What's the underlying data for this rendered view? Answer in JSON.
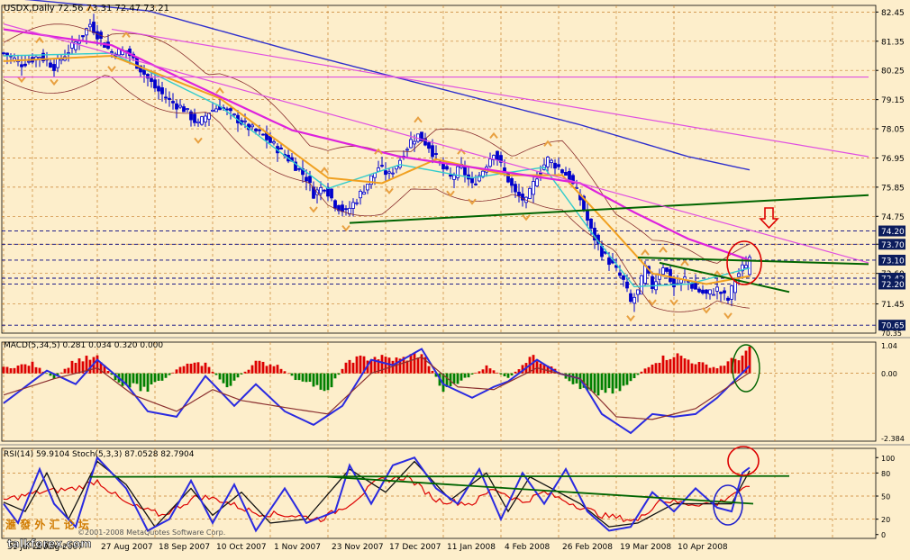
{
  "header": {
    "main": "USDX,Daily  72.56 73.31 72.47 73.21",
    "macd": "MACD(5,34,5) 0.281 0.034 0.320 0.000",
    "rsi": "RSI(14) 59.9104  Stoch(5,3,3) 87.0528 82.7904"
  },
  "watermark": {
    "cn": "滙 發 外 汇 论 坛",
    "site": "talkforex.com",
    "meta": "©2001-2008 MetaQuotes Software Corp."
  },
  "colors": {
    "bg": "#fdeecb",
    "grid": "#c8802c",
    "price": "#0000cc",
    "ma_fast": "#33cccc",
    "ma_orange": "#f0a020",
    "ma_magenta": "#dd22dd",
    "ma_blue": "#3030cc",
    "ma_brown": "#8b3030",
    "trend_green": "#006400",
    "trend_pink": "#e050e0",
    "hist_up": "#dd0000",
    "hist_down": "#008000",
    "fractal": "#e8a040",
    "level_line": "#000080",
    "circle_red": "#dd0000",
    "circle_green": "#006400",
    "circle_blue": "#2020cc"
  },
  "chart_data": [
    {
      "type": "candlestick",
      "panel": "price",
      "symbol": "USDX",
      "timeframe": "Daily",
      "last_ohlc": {
        "open": 72.56,
        "high": 73.31,
        "low": 72.47,
        "close": 73.21
      },
      "ylim": [
        70.35,
        82.7
      ],
      "yticks": [
        "82.45",
        "81.35",
        "80.25",
        "79.15",
        "78.05",
        "76.95",
        "75.85",
        "74.75",
        "73.70",
        "72.60",
        "71.45"
      ],
      "level_labels": [
        {
          "label": "74.20",
          "value": 74.2
        },
        {
          "label": "73.70",
          "value": 73.7
        },
        {
          "label": "73.10",
          "value": 73.1
        },
        {
          "label": "72.42",
          "value": 72.42
        },
        {
          "label": "72.20",
          "value": 72.2
        },
        {
          "label": "70.65",
          "value": 70.65
        }
      ],
      "bottom_label": "70.35",
      "xticks": [
        "31 Jul 2007",
        "2 Aug 2007",
        "27 Aug 2007",
        "18 Sep 2007",
        "10 Oct 2007",
        "1 Nov 2007",
        "23 Nov 2007",
        "17 Dec 2007",
        "11 Jan 2008",
        "4 Feb 2008",
        "26 Feb 2008",
        "19 Mar 2008",
        "10 Apr 2008"
      ],
      "close_keypoints": [
        [
          0,
          80.9
        ],
        [
          5,
          80.5
        ],
        [
          10,
          80.8
        ],
        [
          14,
          80.4
        ],
        [
          18,
          81.0
        ],
        [
          22,
          81.6
        ],
        [
          24,
          82.0
        ],
        [
          27,
          81.4
        ],
        [
          30,
          80.9
        ],
        [
          34,
          81.0
        ],
        [
          38,
          80.3
        ],
        [
          42,
          79.6
        ],
        [
          46,
          79.1
        ],
        [
          50,
          78.8
        ],
        [
          54,
          78.2
        ],
        [
          57,
          78.7
        ],
        [
          60,
          78.9
        ],
        [
          64,
          78.5
        ],
        [
          68,
          78.1
        ],
        [
          72,
          77.8
        ],
        [
          76,
          77.3
        ],
        [
          80,
          76.8
        ],
        [
          84,
          76.2
        ],
        [
          86,
          75.6
        ],
        [
          89,
          75.9
        ],
        [
          92,
          75.2
        ],
        [
          95,
          74.9
        ],
        [
          98,
          75.4
        ],
        [
          101,
          76.0
        ],
        [
          104,
          76.6
        ],
        [
          107,
          76.3
        ],
        [
          110,
          76.9
        ],
        [
          113,
          77.6
        ],
        [
          115,
          77.8
        ],
        [
          118,
          77.4
        ],
        [
          121,
          76.7
        ],
        [
          124,
          76.2
        ],
        [
          127,
          76.6
        ],
        [
          130,
          75.9
        ],
        [
          133,
          76.5
        ],
        [
          136,
          77.2
        ],
        [
          139,
          76.4
        ],
        [
          142,
          75.6
        ],
        [
          145,
          75.3
        ],
        [
          148,
          76.3
        ],
        [
          151,
          76.9
        ],
        [
          154,
          76.6
        ],
        [
          157,
          76.2
        ],
        [
          160,
          75.4
        ],
        [
          163,
          74.2
        ],
        [
          166,
          73.4
        ],
        [
          169,
          72.9
        ],
        [
          172,
          72.3
        ],
        [
          174,
          71.5
        ],
        [
          176,
          71.9
        ],
        [
          178,
          72.8
        ],
        [
          180,
          72.1
        ],
        [
          183,
          72.9
        ],
        [
          186,
          72.1
        ],
        [
          189,
          72.4
        ],
        [
          192,
          72.0
        ],
        [
          195,
          71.8
        ],
        [
          198,
          72.0
        ],
        [
          201,
          71.6
        ],
        [
          203,
          72.4
        ],
        [
          205,
          72.8
        ],
        [
          207,
          73.2
        ]
      ],
      "moving_averages": [
        {
          "role": "ma_fast",
          "keypoints": [
            [
              0,
              80.8
            ],
            [
              30,
              80.9
            ],
            [
              60,
              78.9
            ],
            [
              90,
              75.8
            ],
            [
              110,
              76.7
            ],
            [
              130,
              76.2
            ],
            [
              150,
              76.6
            ],
            [
              165,
              73.8
            ],
            [
              175,
              72.1
            ],
            [
              190,
              72.2
            ],
            [
              207,
              72.8
            ]
          ]
        },
        {
          "role": "ma_orange",
          "keypoints": [
            [
              0,
              80.6
            ],
            [
              30,
              80.8
            ],
            [
              60,
              79.2
            ],
            [
              90,
              76.2
            ],
            [
              105,
              76.0
            ],
            [
              120,
              76.9
            ],
            [
              140,
              76.3
            ],
            [
              155,
              76.3
            ],
            [
              168,
              74.4
            ],
            [
              180,
              72.6
            ],
            [
              195,
              72.2
            ],
            [
              207,
              72.5
            ]
          ]
        },
        {
          "role": "ma_magenta",
          "keypoints": [
            [
              0,
              81.8
            ],
            [
              30,
              81.2
            ],
            [
              50,
              79.9
            ],
            [
              80,
              78.0
            ],
            [
              110,
              77.0
            ],
            [
              140,
              76.4
            ],
            [
              160,
              76.0
            ],
            [
              175,
              74.9
            ],
            [
              190,
              73.9
            ],
            [
              207,
              73.1
            ]
          ]
        },
        {
          "role": "ma_blue",
          "keypoints": [
            [
              0,
              83.0
            ],
            [
              40,
              82.5
            ],
            [
              80,
              81.0
            ],
            [
              120,
              79.6
            ],
            [
              160,
              78.2
            ],
            [
              190,
              77.0
            ],
            [
              207,
              76.5
            ]
          ]
        }
      ],
      "trendlines": [
        {
          "role": "trend_green",
          "from": [
            96,
            74.5
          ],
          "to": [
            240,
            75.55
          ]
        },
        {
          "role": "trend_green",
          "from": [
            176,
            73.2
          ],
          "to": [
            240,
            72.95
          ]
        },
        {
          "role": "trend_green",
          "from": [
            182,
            73.0
          ],
          "to": [
            218,
            71.9
          ]
        },
        {
          "role": "trend_pink",
          "from": [
            0,
            82.0
          ],
          "to": [
            240,
            73.0
          ]
        },
        {
          "role": "trend_pink",
          "from": [
            30,
            81.8
          ],
          "to": [
            240,
            77.0
          ]
        },
        {
          "role": "trend_pink",
          "from": [
            0,
            80.0
          ],
          "to": [
            240,
            80.0
          ]
        }
      ]
    },
    {
      "type": "bar",
      "panel": "macd",
      "ylim": [
        -2.5,
        1.15
      ],
      "yticks": [
        "1.04",
        "0.00",
        "-2.384"
      ],
      "histogram_keypoints": [
        [
          0,
          0.2
        ],
        [
          8,
          0.35
        ],
        [
          14,
          -0.2
        ],
        [
          20,
          0.5
        ],
        [
          26,
          0.55
        ],
        [
          32,
          -0.35
        ],
        [
          40,
          -0.6
        ],
        [
          50,
          0.3
        ],
        [
          56,
          0.35
        ],
        [
          62,
          -0.5
        ],
        [
          70,
          0.4
        ],
        [
          76,
          0.3
        ],
        [
          82,
          -0.3
        ],
        [
          90,
          -0.6
        ],
        [
          96,
          0.5
        ],
        [
          103,
          0.6
        ],
        [
          110,
          0.5
        ],
        [
          116,
          0.75
        ],
        [
          122,
          -0.6
        ],
        [
          128,
          -0.2
        ],
        [
          134,
          0.25
        ],
        [
          140,
          -0.2
        ],
        [
          146,
          0.6
        ],
        [
          152,
          0.3
        ],
        [
          158,
          -0.4
        ],
        [
          166,
          -0.7
        ],
        [
          172,
          -0.5
        ],
        [
          180,
          0.4
        ],
        [
          186,
          0.7
        ],
        [
          192,
          0.4
        ],
        [
          198,
          0.2
        ],
        [
          207,
          0.8
        ]
      ],
      "line_keypoints": [
        [
          0,
          -1.1
        ],
        [
          12,
          0.1
        ],
        [
          20,
          -0.4
        ],
        [
          26,
          0.5
        ],
        [
          34,
          -0.4
        ],
        [
          40,
          -1.4
        ],
        [
          48,
          -1.6
        ],
        [
          56,
          -0.1
        ],
        [
          64,
          -1.2
        ],
        [
          70,
          -0.4
        ],
        [
          78,
          -1.4
        ],
        [
          86,
          -1.9
        ],
        [
          94,
          -1.2
        ],
        [
          102,
          0.5
        ],
        [
          108,
          0.3
        ],
        [
          116,
          0.9
        ],
        [
          122,
          -0.4
        ],
        [
          130,
          -0.9
        ],
        [
          136,
          -0.5
        ],
        [
          140,
          -0.3
        ],
        [
          148,
          0.5
        ],
        [
          154,
          0.0
        ],
        [
          160,
          -0.2
        ],
        [
          166,
          -1.5
        ],
        [
          174,
          -2.2
        ],
        [
          180,
          -1.5
        ],
        [
          186,
          -1.6
        ],
        [
          192,
          -1.5
        ],
        [
          198,
          -0.9
        ],
        [
          207,
          0.28
        ]
      ],
      "signal_keypoints": [
        [
          0,
          -0.8
        ],
        [
          14,
          -0.2
        ],
        [
          26,
          0.2
        ],
        [
          36,
          -0.8
        ],
        [
          48,
          -1.4
        ],
        [
          58,
          -0.6
        ],
        [
          66,
          -1.0
        ],
        [
          80,
          -1.3
        ],
        [
          90,
          -1.5
        ],
        [
          102,
          0.0
        ],
        [
          116,
          0.6
        ],
        [
          126,
          -0.5
        ],
        [
          136,
          -0.6
        ],
        [
          148,
          0.2
        ],
        [
          160,
          -0.2
        ],
        [
          170,
          -1.6
        ],
        [
          180,
          -1.7
        ],
        [
          192,
          -1.3
        ],
        [
          207,
          0.03
        ]
      ]
    },
    {
      "type": "line",
      "panel": "rsi_stoch",
      "ylim": [
        -5,
        112
      ],
      "yticks": [
        "100",
        "80",
        "50",
        "20",
        "0"
      ],
      "hlines": [
        80,
        50,
        20
      ],
      "rsi_keypoints": [
        [
          0,
          45
        ],
        [
          10,
          55
        ],
        [
          20,
          60
        ],
        [
          26,
          70
        ],
        [
          34,
          40
        ],
        [
          44,
          25
        ],
        [
          54,
          50
        ],
        [
          60,
          45
        ],
        [
          70,
          28
        ],
        [
          80,
          25
        ],
        [
          88,
          20
        ],
        [
          96,
          40
        ],
        [
          104,
          70
        ],
        [
          112,
          75
        ],
        [
          120,
          45
        ],
        [
          130,
          40
        ],
        [
          136,
          60
        ],
        [
          144,
          42
        ],
        [
          150,
          55
        ],
        [
          158,
          40
        ],
        [
          166,
          25
        ],
        [
          176,
          18
        ],
        [
          182,
          45
        ],
        [
          190,
          40
        ],
        [
          198,
          40
        ],
        [
          203,
          55
        ],
        [
          207,
          60
        ]
      ],
      "stoch_keypoints": [
        [
          0,
          40
        ],
        [
          4,
          15
        ],
        [
          10,
          85
        ],
        [
          14,
          40
        ],
        [
          20,
          10
        ],
        [
          26,
          100
        ],
        [
          34,
          60
        ],
        [
          40,
          5
        ],
        [
          46,
          20
        ],
        [
          52,
          70
        ],
        [
          58,
          15
        ],
        [
          64,
          65
        ],
        [
          70,
          5
        ],
        [
          78,
          60
        ],
        [
          84,
          15
        ],
        [
          92,
          30
        ],
        [
          96,
          90
        ],
        [
          102,
          40
        ],
        [
          108,
          90
        ],
        [
          114,
          100
        ],
        [
          120,
          60
        ],
        [
          126,
          40
        ],
        [
          132,
          85
        ],
        [
          138,
          20
        ],
        [
          144,
          80
        ],
        [
          150,
          40
        ],
        [
          156,
          85
        ],
        [
          162,
          30
        ],
        [
          168,
          5
        ],
        [
          174,
          10
        ],
        [
          180,
          55
        ],
        [
          186,
          30
        ],
        [
          192,
          60
        ],
        [
          198,
          35
        ],
        [
          202,
          30
        ],
        [
          205,
          80
        ],
        [
          207,
          87
        ]
      ],
      "stoch_signal_keypoints": [
        [
          0,
          42
        ],
        [
          6,
          30
        ],
        [
          12,
          80
        ],
        [
          18,
          20
        ],
        [
          26,
          95
        ],
        [
          34,
          65
        ],
        [
          42,
          10
        ],
        [
          52,
          60
        ],
        [
          58,
          25
        ],
        [
          66,
          55
        ],
        [
          74,
          15
        ],
        [
          84,
          20
        ],
        [
          96,
          85
        ],
        [
          106,
          55
        ],
        [
          114,
          95
        ],
        [
          124,
          45
        ],
        [
          134,
          80
        ],
        [
          140,
          30
        ],
        [
          146,
          75
        ],
        [
          154,
          55
        ],
        [
          160,
          40
        ],
        [
          168,
          10
        ],
        [
          176,
          15
        ],
        [
          186,
          40
        ],
        [
          196,
          40
        ],
        [
          202,
          40
        ],
        [
          207,
          83
        ]
      ],
      "trendlines": [
        {
          "role": "trend_green",
          "from": [
            24,
            75
          ],
          "to": [
            218,
            76
          ]
        },
        {
          "role": "trend_green",
          "from": [
            90,
            75
          ],
          "to": [
            208,
            40
          ]
        }
      ]
    }
  ]
}
